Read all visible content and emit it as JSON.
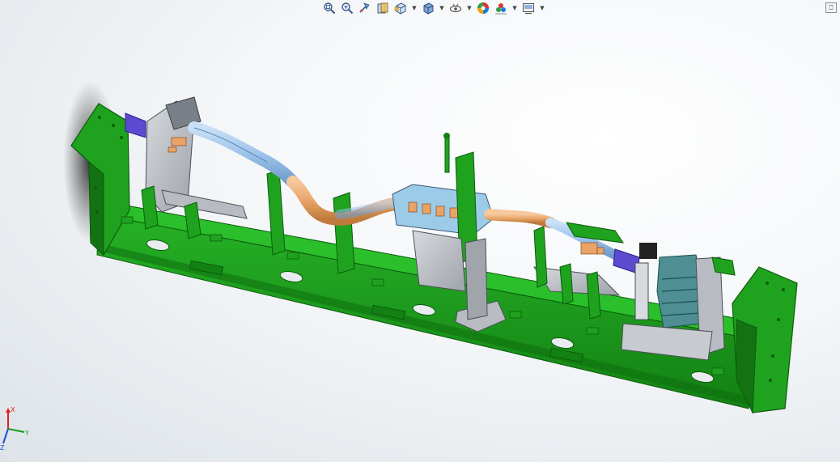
{
  "window": {
    "corner_button_glyph": "⎕"
  },
  "toolbar": {
    "items": [
      {
        "icon": "zoom-to-fit-icon"
      },
      {
        "icon": "zoom-to-area-icon"
      },
      {
        "icon": "previous-view-icon"
      },
      {
        "icon": "section-view-icon"
      },
      {
        "icon": "view-orientation-icon",
        "dropdown": true
      },
      {
        "icon": "display-style-icon",
        "dropdown": true
      },
      {
        "icon": "hide-show-items-icon",
        "dropdown": true
      },
      {
        "icon": "edit-appearance-icon"
      },
      {
        "icon": "apply-scene-icon",
        "dropdown": true
      },
      {
        "icon": "view-settings-icon",
        "dropdown": true
      }
    ],
    "dropdown_glyph": "▼"
  },
  "triad": {
    "x_label": "X",
    "y_label": "Y",
    "z_label": "Z"
  },
  "colors": {
    "base_green": "#1fa31f",
    "base_green_dark": "#137313",
    "steel_gray": "#b8bcc2",
    "hose_blue": "#9fc3ea",
    "hose_orange": "#e8a468",
    "cylinder_teal": "#4f8f94",
    "purple_part": "#5c4bd1"
  }
}
